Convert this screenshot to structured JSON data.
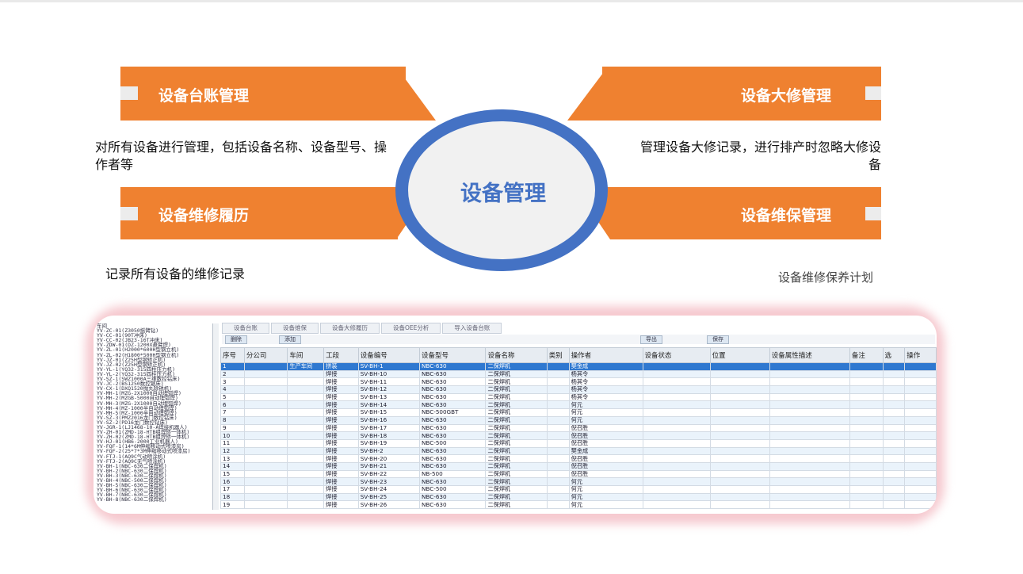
{
  "diagram": {
    "center_title": "设备管理",
    "categories": {
      "ledger": "设备台账管理",
      "overhaul": "设备大修管理",
      "repair_history": "设备维修履历",
      "maintenance": "设备维保管理"
    },
    "descriptions": {
      "ledger": "对所有设备进行管理，包括设备名称、设备型号、操作者等",
      "overhaul": "管理设备大修记录，进行排产时忽略大修设备",
      "repair_history": "记录所有设备的维修记录",
      "maintenance": "设备维修保养计划"
    },
    "colors": {
      "orange": "#ef8130",
      "ring": "#4472c4",
      "center_fill": "#f1f1f1"
    }
  },
  "screenshot": {
    "tree_nodes": [
      "车间",
      "YV-ZC-01(Z3050摇臂钻)",
      "YV-CC-01(90T冲床)",
      "YV-CC-02(JB23-16T冲床)",
      "YV-ZDW-01(DZ-1200X悬臂焊)",
      "YV-ZL-01(H2000*600H型钢立机)",
      "YV-ZL-02(H1800*500H型钢立机)",
      "YV-JZ-01(Z25H型钢矫正机)",
      "YV-JZ-02(Z25H型钢矫正机)",
      "YV-YL-1(YQ32-315四柱压力机)",
      "YV-YL-2(YQ32-315四柱压力机)",
      "YV-SZ-1(SWZ1000A三维数控钻床)",
      "YV-JC-2(BS1250数控锯床)",
      "YV-CX-1(DXQ1520抛丸除锈机)",
      "YV-MH-1(MZG-2X1000自动埋弧焊)",
      "YV-MH-2(MZGB-5000自动埋弧焊)",
      "YV-MH-3(MZG-2X1000自动埋弧焊)",
      "YV-MH-4(MZ-1000半自动埋弧焊)",
      "YV-MH-5(MZ-1000半自动埋弧焊)",
      "YV-SZ-3(PMZ2016龙门数控钻床)",
      "YV-SZ-2(PD16龙门数控钻床)",
      "YV-JGR-1(LJ1468-10-A焊接机器人)",
      "YV-ZH-01(ZMD-18-HTB组焊矫一体机)",
      "YV-ZH-02(ZMD-18-HTB组焊矫一体机)",
      "YV-HJ-01(HB6-2000工业机器人)",
      "YV-FQF-1(14*6M伸缩移动式喷漆房)",
      "YV-FQF-2(25*7*3M伸缩移动式喷漆房)",
      "YV-FTJ-1(AQ9C气动喷涂机)",
      "YV-FTJ-2(AQ9C无气喷涂机)",
      "YV-BH-1(NBC-630二保焊机)",
      "YV-BH-2(NBC-630二保焊机)",
      "YV-BH-3(NBC-630二保焊机)",
      "YV-BH-4(NBC-500二保焊机)",
      "YV-BH-5(NBC-630二保焊机)",
      "YV-BH-6(NBC-630二保焊机)",
      "YV-BH-7(NBC-630二保焊机)",
      "YV-BH-8(NBC-630二保焊机)"
    ],
    "tabs": [
      "设备台账",
      "设备维保",
      "设备大修履历",
      "设备OEE分析",
      "导入设备台账"
    ],
    "toolbar": {
      "delete": "删除",
      "add": "添加",
      "export": "导出",
      "save": "保存"
    },
    "columns": [
      "序号",
      "分公司",
      "车间",
      "工段",
      "设备编号",
      "设备型号",
      "设备名称",
      "类别",
      "操作者",
      "设备状态",
      "位置",
      "设备属性描述",
      "备注",
      "选",
      "操作"
    ],
    "rows": [
      {
        "no": "1",
        "branch": "",
        "workshop": "生产车间",
        "section": "拼装",
        "code": "SV-BH-1",
        "model": "NBC-630",
        "name": "二保焊机",
        "operator": "樊金成"
      },
      {
        "no": "2",
        "branch": "",
        "workshop": "",
        "section": "焊接",
        "code": "SV-BH-10",
        "model": "NBC-630",
        "name": "二保焊机",
        "operator": "杨其令"
      },
      {
        "no": "3",
        "branch": "",
        "workshop": "",
        "section": "焊接",
        "code": "SV-BH-11",
        "model": "NBC-630",
        "name": "二保焊机",
        "operator": "杨其令"
      },
      {
        "no": "4",
        "branch": "",
        "workshop": "",
        "section": "焊接",
        "code": "SV-BH-12",
        "model": "NBC-630",
        "name": "二保焊机",
        "operator": "杨其令"
      },
      {
        "no": "5",
        "branch": "",
        "workshop": "",
        "section": "焊接",
        "code": "SV-BH-13",
        "model": "NBC-630",
        "name": "二保焊机",
        "operator": "杨其令"
      },
      {
        "no": "6",
        "branch": "",
        "workshop": "",
        "section": "焊接",
        "code": "SV-BH-14",
        "model": "NBC-630",
        "name": "二保焊机",
        "operator": "何元"
      },
      {
        "no": "7",
        "branch": "",
        "workshop": "",
        "section": "焊接",
        "code": "SV-BH-15",
        "model": "NBC-500GBT",
        "name": "二保焊机",
        "operator": "何元"
      },
      {
        "no": "8",
        "branch": "",
        "workshop": "",
        "section": "焊接",
        "code": "SV-BH-16",
        "model": "NBC-630",
        "name": "二保焊机",
        "operator": "何元"
      },
      {
        "no": "9",
        "branch": "",
        "workshop": "",
        "section": "焊接",
        "code": "SV-BH-17",
        "model": "NBC-630",
        "name": "二保焊机",
        "operator": "倪召胜"
      },
      {
        "no": "10",
        "branch": "",
        "workshop": "",
        "section": "焊接",
        "code": "SV-BH-18",
        "model": "NBC-630",
        "name": "二保焊机",
        "operator": "倪召胜"
      },
      {
        "no": "11",
        "branch": "",
        "workshop": "",
        "section": "焊接",
        "code": "SV-BH-19",
        "model": "NBC-500",
        "name": "二保焊机",
        "operator": "倪召胜"
      },
      {
        "no": "12",
        "branch": "",
        "workshop": "",
        "section": "焊接",
        "code": "SV-BH-2",
        "model": "NBC-630",
        "name": "二保焊机",
        "operator": "樊金成"
      },
      {
        "no": "13",
        "branch": "",
        "workshop": "",
        "section": "焊接",
        "code": "SV-BH-20",
        "model": "NBC-630",
        "name": "二保焊机",
        "operator": "倪召胜"
      },
      {
        "no": "14",
        "branch": "",
        "workshop": "",
        "section": "焊接",
        "code": "SV-BH-21",
        "model": "NBC-630",
        "name": "二保焊机",
        "operator": "倪召胜"
      },
      {
        "no": "15",
        "branch": "",
        "workshop": "",
        "section": "焊接",
        "code": "SV-BH-22",
        "model": "NB-500",
        "name": "二保焊机",
        "operator": "倪召胜"
      },
      {
        "no": "16",
        "branch": "",
        "workshop": "",
        "section": "焊接",
        "code": "SV-BH-23",
        "model": "NBC-630",
        "name": "二保焊机",
        "operator": "何元"
      },
      {
        "no": "17",
        "branch": "",
        "workshop": "",
        "section": "焊接",
        "code": "SV-BH-24",
        "model": "NBC-500",
        "name": "二保焊机",
        "operator": "何元"
      },
      {
        "no": "18",
        "branch": "",
        "workshop": "",
        "section": "焊接",
        "code": "SV-BH-25",
        "model": "NBC-630",
        "name": "二保焊机",
        "operator": "何元"
      },
      {
        "no": "19",
        "branch": "",
        "workshop": "",
        "section": "焊接",
        "code": "SV-BH-26",
        "model": "NBC-630",
        "name": "二保焊机",
        "operator": "何元"
      }
    ]
  }
}
